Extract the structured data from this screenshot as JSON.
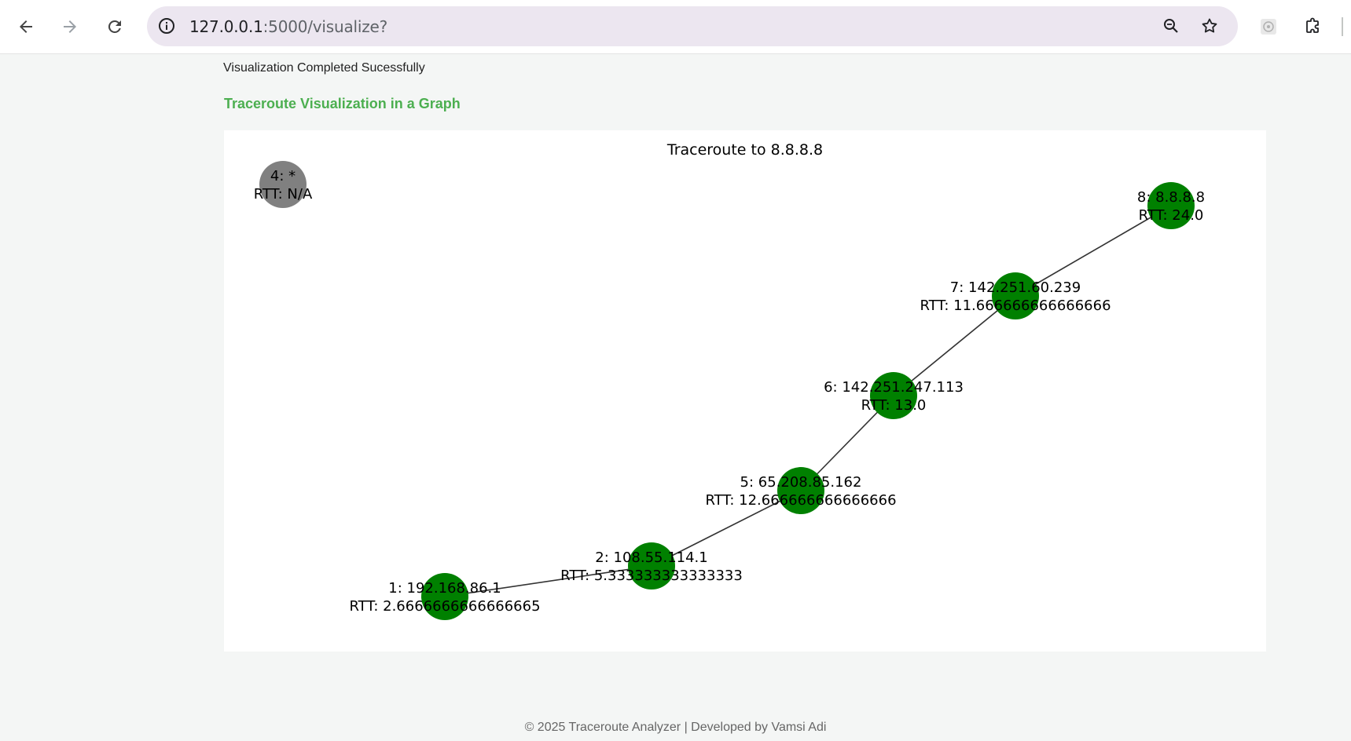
{
  "browser": {
    "url_host": "127.0.0.1",
    "url_rest": ":5000/visualize?",
    "icons": [
      "back-icon",
      "forward-icon",
      "reload-icon",
      "site-info-icon",
      "zoom-icon",
      "bookmark-star-icon",
      "extension-app-icon",
      "extensions-puzzle-icon"
    ]
  },
  "page": {
    "status_message": "Visualization Completed Sucessfully",
    "section_title": "Traceroute Visualization in a Graph",
    "footer": "© 2025 Traceroute Analyzer | Developed by Vamsi Adi"
  },
  "chart_data": {
    "type": "network-graph",
    "title": "Traceroute to 8.8.8.8",
    "colors": {
      "responding": "#008000",
      "timeout": "#808080",
      "edge": "#333333"
    },
    "nodes": [
      {
        "id": "1",
        "label": "1: 192.168.86.1",
        "rtt_label": "RTT: 2.6666666666666665",
        "status": "responding"
      },
      {
        "id": "2",
        "label": "2: 108.55.114.1",
        "rtt_label": "RTT: 5.333333333333333",
        "status": "responding"
      },
      {
        "id": "4",
        "label": "4: *",
        "rtt_label": "RTT: N/A",
        "status": "timeout"
      },
      {
        "id": "5",
        "label": "5: 65.208.85.162",
        "rtt_label": "RTT: 12.666666666666666",
        "status": "responding"
      },
      {
        "id": "6",
        "label": "6: 142.251.247.113",
        "rtt_label": "RTT: 13.0",
        "status": "responding"
      },
      {
        "id": "7",
        "label": "7: 142.251.60.239",
        "rtt_label": "RTT: 11.666666666666666",
        "status": "responding"
      },
      {
        "id": "8",
        "label": "8: 8.8.8.8",
        "rtt_label": "RTT: 24.0",
        "status": "responding"
      }
    ],
    "edges": [
      [
        "1",
        "2"
      ],
      [
        "2",
        "5"
      ],
      [
        "5",
        "6"
      ],
      [
        "6",
        "7"
      ],
      [
        "7",
        "8"
      ]
    ]
  }
}
